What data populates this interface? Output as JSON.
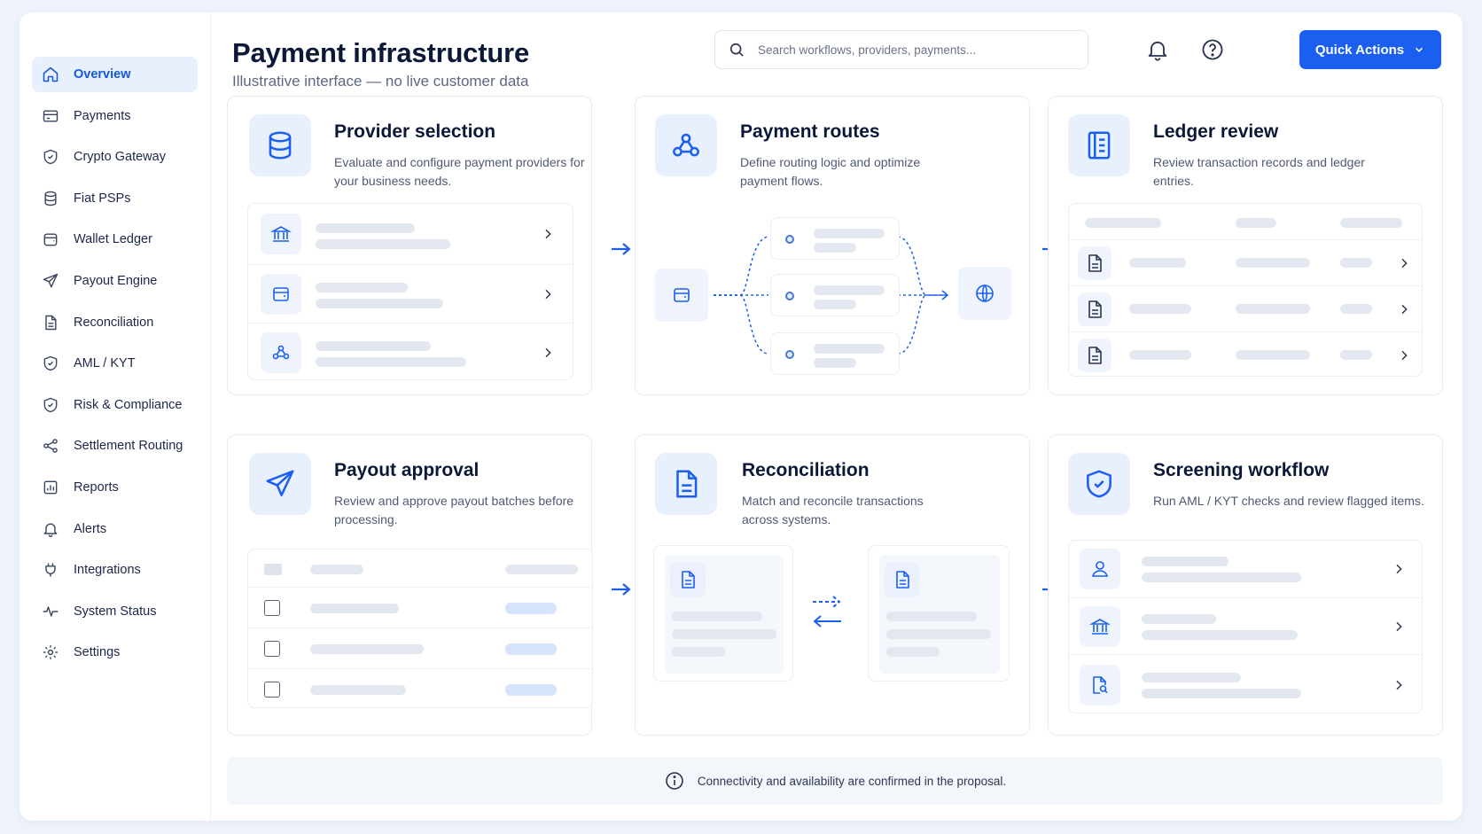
{
  "header": {
    "title": "Payment infrastructure",
    "subtitle": "Illustrative interface — no live customer data",
    "search_placeholder": "Search workflows, providers, payments...",
    "quick_actions_label": "Quick Actions"
  },
  "sidebar": {
    "items": [
      {
        "label": "Overview",
        "icon": "home-icon",
        "active": true
      },
      {
        "label": "Payments",
        "icon": "card-icon"
      },
      {
        "label": "Crypto Gateway",
        "icon": "shield-icon"
      },
      {
        "label": "Fiat PSPs",
        "icon": "database-icon"
      },
      {
        "label": "Wallet Ledger",
        "icon": "wallet-icon"
      },
      {
        "label": "Payout Engine",
        "icon": "send-icon"
      },
      {
        "label": "Reconciliation",
        "icon": "document-icon"
      },
      {
        "label": "AML / KYT",
        "icon": "shield-icon"
      },
      {
        "label": "Risk & Compliance",
        "icon": "shield-check-icon"
      },
      {
        "label": "Settlement Routing",
        "icon": "share-icon"
      },
      {
        "label": "Reports",
        "icon": "report-icon"
      },
      {
        "label": "Alerts",
        "icon": "bell-icon"
      },
      {
        "label": "Integrations",
        "icon": "plug-icon"
      },
      {
        "label": "System Status",
        "icon": "pulse-icon"
      },
      {
        "label": "Settings",
        "icon": "gear-icon"
      }
    ]
  },
  "cards": {
    "provider": {
      "title": "Provider selection",
      "desc": "Evaluate and configure payment providers for your business needs."
    },
    "routes": {
      "title": "Payment routes",
      "desc": "Define routing logic and optimize payment flows."
    },
    "ledger": {
      "title": "Ledger review",
      "desc": "Review transaction records and ledger entries."
    },
    "payout": {
      "title": "Payout approval",
      "desc": "Review and approve payout batches before processing."
    },
    "recon": {
      "title": "Reconciliation",
      "desc": "Match and reconcile transactions across systems."
    },
    "screening": {
      "title": "Screening workflow",
      "desc": "Run AML / KYT checks and review flagged items."
    }
  },
  "footer": {
    "text": "Connectivity and availability are confirmed in the proposal."
  },
  "colors": {
    "accent": "#1a5ff0",
    "icon_bg": "#e9f0fd",
    "placeholder": "#e3e8f0"
  }
}
